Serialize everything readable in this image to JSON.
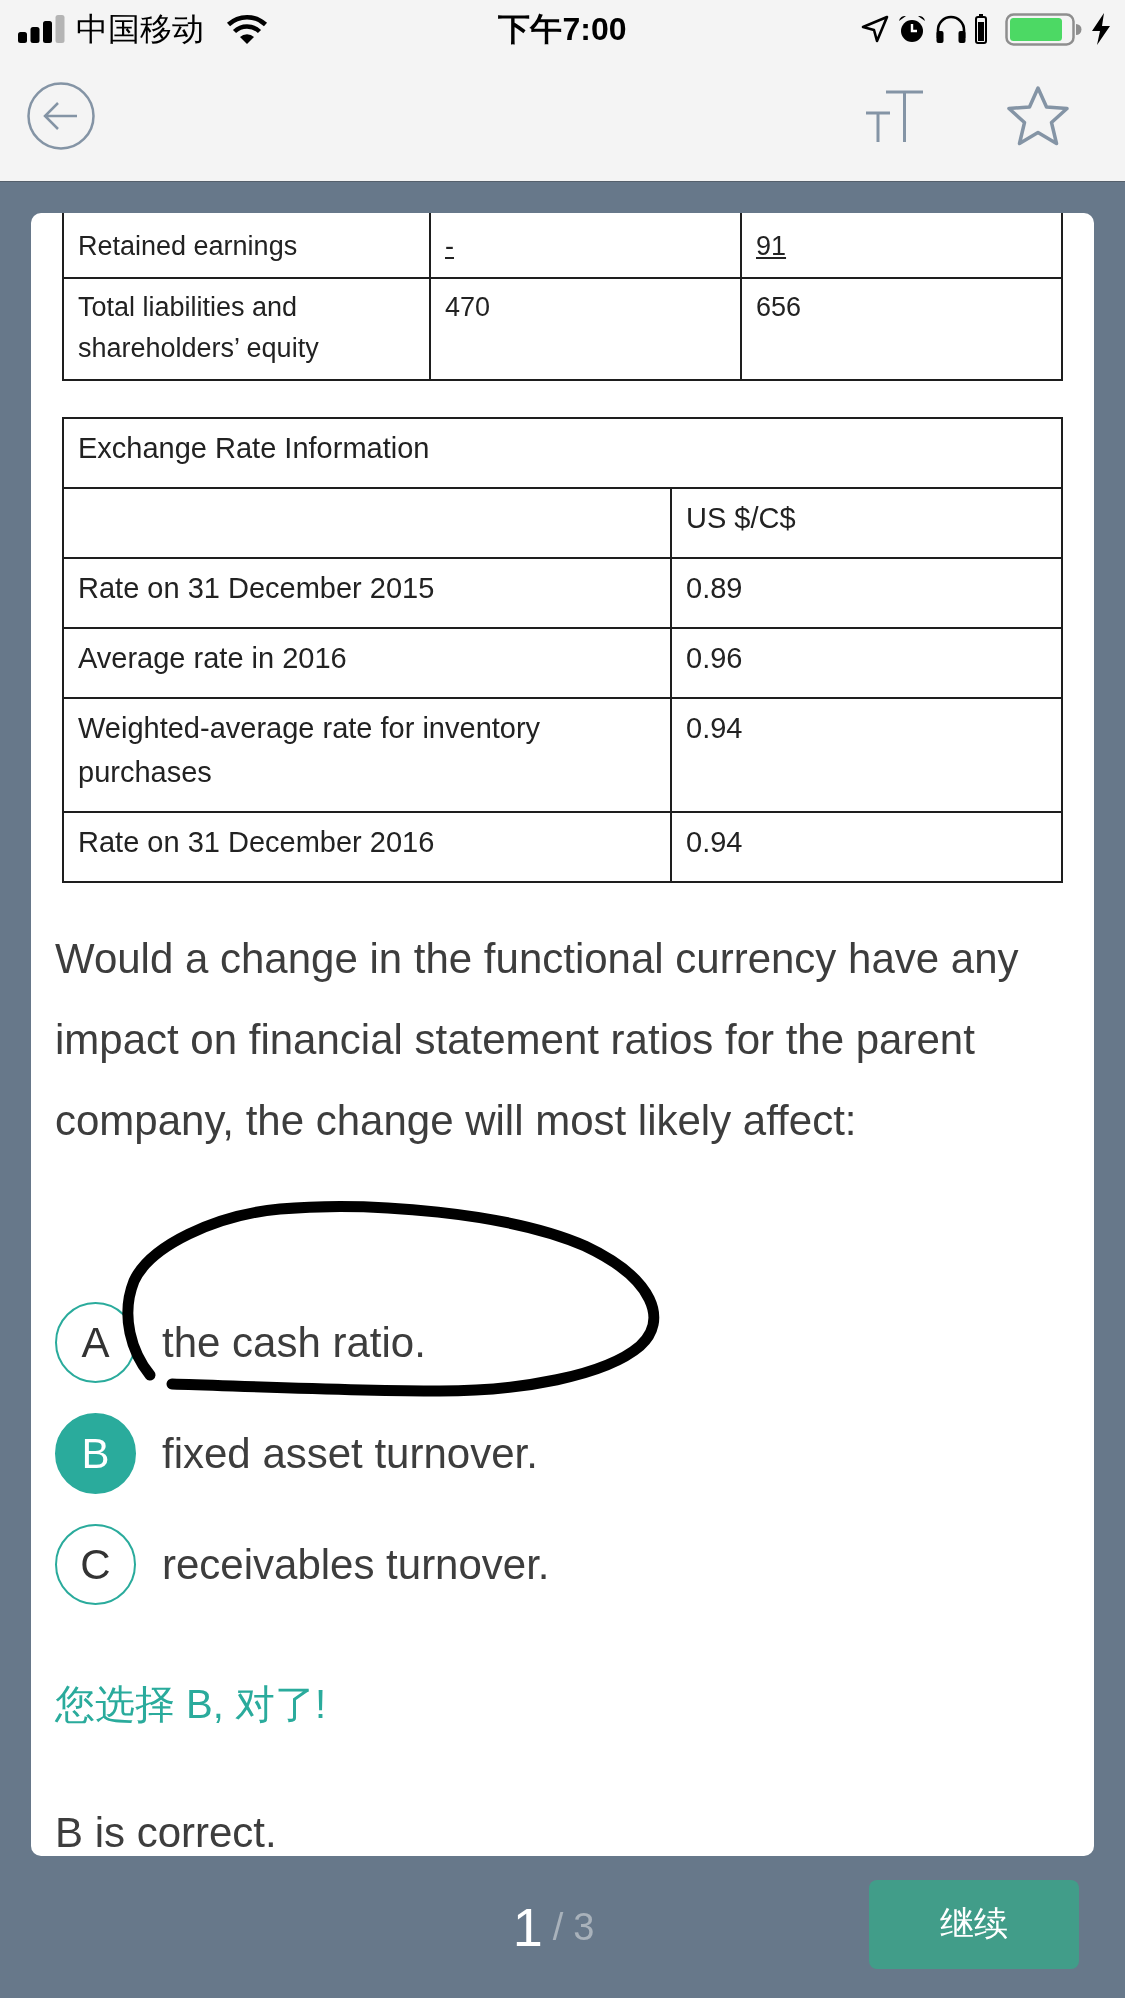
{
  "status_bar": {
    "carrier": "中国移动",
    "time": "下午7:00"
  },
  "balance_sheet_table": {
    "rows": [
      {
        "cells": [
          {
            "text": "Retained earnings",
            "underlined": false
          },
          {
            "text": "-",
            "underlined": true
          },
          {
            "text": "91",
            "underlined": true
          }
        ]
      },
      {
        "cells": [
          {
            "text": "Total liabilities and shareholders’ equity",
            "underlined": false
          },
          {
            "text": "470",
            "underlined": false
          },
          {
            "text": "656",
            "underlined": false
          }
        ]
      }
    ]
  },
  "exchange_rate_table": {
    "title": "Exchange Rate Information",
    "header": "US $/C$",
    "rows": [
      {
        "label": "Rate on 31 December 2015",
        "value": "0.89"
      },
      {
        "label": "Average rate in 2016",
        "value": "0.96"
      },
      {
        "label": "Weighted-average rate for inventory purchases",
        "value": "0.94"
      },
      {
        "label": "Rate on 31 December 2016",
        "value": "0.94"
      }
    ]
  },
  "question": "Would a change in the functional currency have any impact on financial statement ratios for the parent company, the change will most likely affect:",
  "options": [
    {
      "letter": "A",
      "text": "the cash ratio.",
      "selected": false
    },
    {
      "letter": "B",
      "text": "fixed asset turnover.",
      "selected": true
    },
    {
      "letter": "C",
      "text": "receivables turnover.",
      "selected": false
    }
  ],
  "feedback": {
    "text": "您选择 B, 对了!",
    "correct": true
  },
  "explanation": "B is correct.",
  "pager": {
    "current": "1",
    "separator": "/",
    "total": "3"
  },
  "continue_button": "继续"
}
